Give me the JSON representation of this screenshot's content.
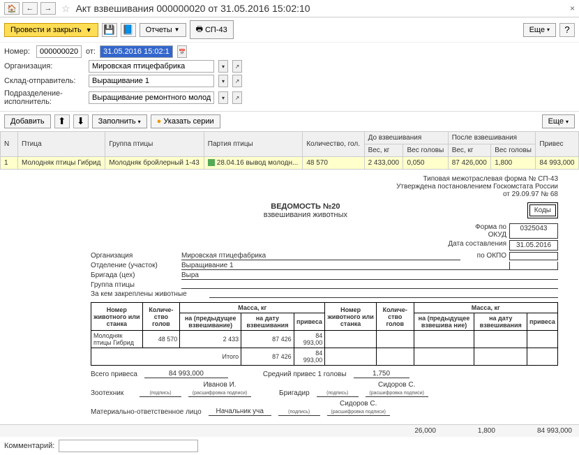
{
  "header": {
    "title": "Акт взвешивания 000000020 от 31.05.2016 15:02:10"
  },
  "toolbar": {
    "save_close": "Провести и закрыть",
    "reports": "Отчеты",
    "sp43": "СП-43",
    "more": "Еще",
    "help": "?"
  },
  "form": {
    "number_label": "Номер:",
    "number": "000000020",
    "date_label": "от:",
    "date": "31.05.2016 15:02:10",
    "org_label": "Организация:",
    "org": "Мировская птицефабрика",
    "warehouse_label": "Склад-отправитель:",
    "warehouse": "Выращивание 1",
    "division_label": "Подразделение-исполнитель:",
    "division": "Выращивание ремонтного молодняка"
  },
  "actions": {
    "add": "Добавить",
    "fill": "Заполнить",
    "series": "Указать серии"
  },
  "table": {
    "headers": {
      "n": "N",
      "bird": "Птица",
      "group": "Группа птицы",
      "batch": "Партия птицы",
      "qty": "Количество, гол.",
      "before": "До взвешивания",
      "after": "После взвешивания",
      "gain": "Привес",
      "weight_kg": "Вес, кг",
      "weight_head": "Вес головы"
    },
    "row": {
      "n": "1",
      "bird": "Молодняк птицы Гибрид",
      "group": "Молодняк бройлерный 1-43",
      "batch": "28.04.16 вывод молодн...",
      "qty": "48 570",
      "before_kg": "2 433,000",
      "before_head": "0,050",
      "after_kg": "87 426,000",
      "after_head": "1,800",
      "gain": "84 993,000"
    }
  },
  "report": {
    "line1": "Типовая межотраслевая форма № СП-43",
    "line2": "Утверждена постановлением Госкомстата России",
    "line3": "от 29.09.97 № 68",
    "title1": "ВЕДОМОСТЬ №20",
    "title2": "взвешивания животных",
    "codes_label": "Коды",
    "okud_label": "Форма по ОКУД",
    "okud": "0325043",
    "date_label": "Дата составления",
    "date": "31.05.2016",
    "okpo_label": "по ОКПО",
    "org_label": "Организация",
    "org": "Мировская птицефабрика",
    "dept_label": "Отделение (участок)",
    "dept": "Выращивание 1",
    "brigade_label": "Бригада (цех)",
    "brigade": "Выра",
    "group_label": "Группа птицы",
    "assigned_label": "За кем закреплены животные"
  },
  "ved_headers": {
    "animal_no": "Номер животного или станка",
    "qty": "Количе-ство голов",
    "mass_kg": "Масса, кг",
    "before": "на (предыдущее взвешивание)",
    "on_date": "на дату взвешивания",
    "gain": "привеса",
    "prev_short": "на (предыдущее взвешива ние)"
  },
  "ved_row": {
    "name": "Молодняк птицы Гибрид",
    "qty": "48 570",
    "before": "2 433",
    "on_date": "87 426",
    "gain": "84 993,00",
    "total_label": "Итого",
    "total_on_date": "87 426",
    "total_gain": "84 993,00"
  },
  "footer_totals": {
    "v1": "26,000",
    "v2": "1,800",
    "v3": "84 993,000"
  },
  "summary": {
    "total_gain_label": "Всего привеса",
    "total_gain": "84 993,000",
    "avg_label": "Средний привес 1 головы",
    "avg": "1,750",
    "zoo_label": "Зоотехник",
    "zoo_name": "Иванов И.",
    "brigadir_label": "Бригадир",
    "sidorov": "Сидоров С.",
    "mat_label": "Материально-ответственное лицо",
    "chief": "Начальник уча",
    "sig_hint": "(подпись)",
    "sig_hint2": "(расшифровка подписи)"
  },
  "comment_label": "Комментарий:"
}
